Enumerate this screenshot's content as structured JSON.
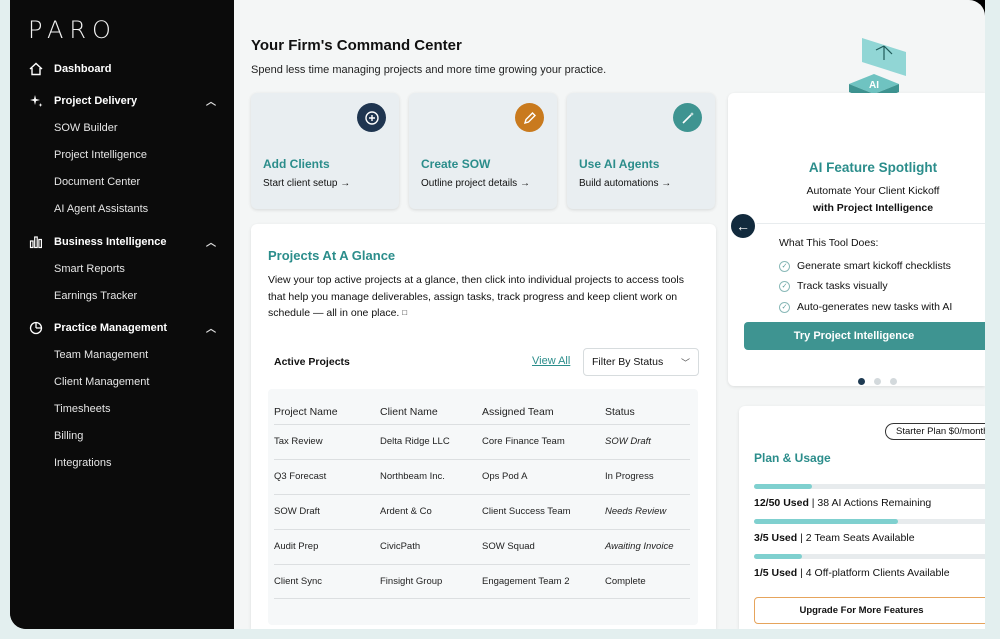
{
  "brand": {
    "logo": "PARO"
  },
  "sidebar": {
    "dashboard": "Dashboard",
    "sections": [
      {
        "label": "Project Delivery",
        "items": [
          "SOW Builder",
          "Project Intelligence",
          "Document Center",
          "AI Agent Assistants"
        ]
      },
      {
        "label": "Business Intelligence",
        "items": [
          "Smart Reports",
          "Earnings Tracker"
        ]
      },
      {
        "label": "Practice Management",
        "items": [
          "Team Management",
          "Client Management",
          "Timesheets",
          "Billing",
          "Integrations"
        ]
      }
    ]
  },
  "header": {
    "title": "Your Firm's Command Center",
    "subtitle": "Spend less time managing projects and more time growing your practice."
  },
  "quick_actions": [
    {
      "title": "Add Clients",
      "subtitle": "Start client setup →",
      "icon": "plus-circle-icon",
      "color": "#1f3550"
    },
    {
      "title": "Create SOW",
      "subtitle": "Outline project details →",
      "icon": "pencil-icon",
      "color": "#c97a1e"
    },
    {
      "title": "Use AI Agents",
      "subtitle": "Build automations →",
      "icon": "magic-wand-icon",
      "color": "#3e9491"
    }
  ],
  "projects": {
    "title": "Projects At A Glance",
    "description": "View your top active projects at a glance, then click into individual projects to access tools that help you manage deliverables, assign tasks, track progress and keep client work on schedule — all in one place.",
    "active_label": "Active Projects",
    "view_all": "View All",
    "filter": "Filter By Status",
    "columns": [
      "Project Name",
      "Client Name",
      "Assigned Team",
      "Status"
    ],
    "rows": [
      [
        "Tax Review",
        "Delta Ridge LLC",
        "Core Finance Team",
        "SOW Draft"
      ],
      [
        "Q3 Forecast",
        "Northbeam Inc.",
        "Ops Pod A",
        "In Progress"
      ],
      [
        "SOW Draft",
        "Ardent & Co",
        "Client Success Team",
        "Needs Review"
      ],
      [
        "Audit Prep",
        "CivicPath",
        "SOW Squad",
        "Awaiting Invoice"
      ],
      [
        "Client Sync",
        "Finsight Group",
        "Engagement Team 2",
        "Complete"
      ]
    ]
  },
  "spotlight": {
    "badge": "AI",
    "title": "AI Feature Spotlight",
    "subtitle_1": "Automate Your Client Kickoff",
    "subtitle_2": "with Project Intelligence",
    "what_label": "What This Tool Does:",
    "features": [
      "Generate smart kickoff checklists",
      "Track tasks visually",
      "Auto-generates new tasks with AI"
    ],
    "cta": "Try Project Intelligence",
    "page_count": 3,
    "active_page": 1
  },
  "plan": {
    "pill": "Starter Plan $0/month",
    "title": "Plan & Usage",
    "usage": [
      {
        "bold": "12/50 Used",
        "rest": " | 38 AI Actions Remaining",
        "fraction": 0.24
      },
      {
        "bold": "3/5 Used",
        "rest": " | 2 Team Seats Available",
        "fraction": 0.6
      },
      {
        "bold": "1/5 Used",
        "rest": " | 4 Off-platform Clients Available",
        "fraction": 0.2
      }
    ],
    "upgrade": "Upgrade For More Features"
  },
  "colors": {
    "accent": "#2b8d8b",
    "sidebar_bg": "#0b0b0b",
    "page_bg": "#e3efef"
  }
}
